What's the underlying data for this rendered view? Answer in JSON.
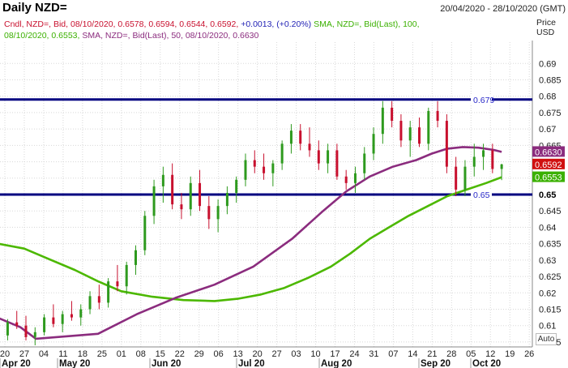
{
  "header": {
    "title": "Daily NZD=",
    "date_range": "20/04/2020 - 28/10/2020 (GMT)"
  },
  "legend": {
    "line1_cndl": "Cndl, NZD=, Bid, 08/10/2020, 0.6578, 0.6594, 0.6544, 0.6592,",
    "line1_change": "+0.0013, (+0.20%)",
    "line1_sma100": "SMA, NZD=, Bid(Last),  100,",
    "line2_sma100_value": "08/10/2020, 0.6553,",
    "line2_sma50": "SMA, NZD=, Bid(Last),  50, 08/10/2020, 0.6630"
  },
  "axis": {
    "price_label": "Price",
    "currency_label": "USD"
  },
  "controls": {
    "auto_label": "Auto"
  },
  "chart_data": {
    "type": "candlestick",
    "ylim": [
      0.6035,
      0.6965
    ],
    "y_ticks": [
      "0.69",
      "0.685",
      "0.68",
      "0.675",
      "0.67",
      "0.665",
      "0.66",
      "0.655",
      "0.65",
      "0.645",
      "0.64",
      "0.635",
      "0.63",
      "0.625",
      "0.62",
      "0.615",
      "0.61",
      "0.605"
    ],
    "x_ticks": [
      "20",
      "27",
      "04",
      "11",
      "18",
      "25",
      "01",
      "08",
      "15",
      "22",
      "29",
      "06",
      "13",
      "20",
      "27",
      "03",
      "10",
      "17",
      "24",
      "31",
      "07",
      "14",
      "21",
      "28",
      "05",
      "12",
      "19",
      "26"
    ],
    "month_labels": [
      "Apr 20",
      "May 20",
      "Jun 20",
      "Jul 20",
      "Aug 20",
      "Sep 20",
      "Oct 20"
    ],
    "horizontal_lines": [
      {
        "value": 0.679,
        "label": "0.679"
      },
      {
        "value": 0.65,
        "label": "0.65"
      }
    ],
    "price_tags": [
      {
        "value": 0.663,
        "label": "0.6630",
        "color": "#8b2c7e"
      },
      {
        "value": 0.6592,
        "label": "0.6592",
        "color": "#d01010"
      },
      {
        "value": 0.6553,
        "label": "0.6553",
        "color": "#3bb000"
      },
      {
        "value": 0.65,
        "label": "0.65",
        "color": "#ffffff"
      }
    ],
    "series": [
      {
        "name": "SMA 100",
        "color": "#4cb800",
        "points": [
          [
            -4,
            0.6355
          ],
          [
            5,
            0.6335
          ],
          [
            12,
            0.63
          ],
          [
            18,
            0.627
          ],
          [
            24,
            0.6235
          ],
          [
            30,
            0.6205
          ],
          [
            38,
            0.6188
          ],
          [
            46,
            0.6178
          ],
          [
            54,
            0.6175
          ],
          [
            60,
            0.6182
          ],
          [
            66,
            0.6195
          ],
          [
            72,
            0.6215
          ],
          [
            78,
            0.6245
          ],
          [
            84,
            0.628
          ],
          [
            89,
            0.632
          ],
          [
            94,
            0.6365
          ],
          [
            99,
            0.64
          ],
          [
            104,
            0.6435
          ],
          [
            109,
            0.6465
          ],
          [
            114,
            0.6495
          ],
          [
            119,
            0.6515
          ],
          [
            124,
            0.6535
          ],
          [
            128,
            0.6553
          ]
        ]
      },
      {
        "name": "SMA 50",
        "color": "#8b2c7e",
        "points": [
          [
            -4,
            0.6135
          ],
          [
            4,
            0.6095
          ],
          [
            8,
            0.606
          ],
          [
            24,
            0.6075
          ],
          [
            34,
            0.6135
          ],
          [
            44,
            0.6185
          ],
          [
            54,
            0.6225
          ],
          [
            64,
            0.628
          ],
          [
            74,
            0.6365
          ],
          [
            82,
            0.645
          ],
          [
            88,
            0.651
          ],
          [
            94,
            0.6555
          ],
          [
            100,
            0.6585
          ],
          [
            106,
            0.6605
          ],
          [
            110,
            0.6625
          ],
          [
            114,
            0.664
          ],
          [
            118,
            0.6645
          ],
          [
            122,
            0.6643
          ],
          [
            126,
            0.6636
          ],
          [
            128,
            0.663
          ]
        ]
      }
    ],
    "candles_ohlc_sampled": [
      [
        0.607,
        0.61,
        0.605,
        0.608
      ],
      [
        0.6085,
        0.611,
        0.606,
        0.607
      ],
      [
        0.607,
        0.612,
        0.6055,
        0.611
      ],
      [
        0.611,
        0.6145,
        0.609,
        0.61
      ],
      [
        0.61,
        0.613,
        0.6055,
        0.6065
      ],
      [
        0.6065,
        0.6095,
        0.604,
        0.608
      ],
      [
        0.608,
        0.6135,
        0.607,
        0.6125
      ],
      [
        0.6125,
        0.6165,
        0.6095,
        0.6105
      ],
      [
        0.6105,
        0.6145,
        0.608,
        0.6135
      ],
      [
        0.6135,
        0.6175,
        0.6115,
        0.6125
      ],
      [
        0.6125,
        0.6165,
        0.61,
        0.615
      ],
      [
        0.615,
        0.6205,
        0.6135,
        0.619
      ],
      [
        0.619,
        0.6225,
        0.615,
        0.617
      ],
      [
        0.617,
        0.6245,
        0.6155,
        0.6235
      ],
      [
        0.6235,
        0.6285,
        0.6205,
        0.622
      ],
      [
        0.622,
        0.6295,
        0.6195,
        0.6285
      ],
      [
        0.6285,
        0.6345,
        0.6255,
        0.633
      ],
      [
        0.633,
        0.645,
        0.6315,
        0.6435
      ],
      [
        0.6435,
        0.6545,
        0.641,
        0.6525
      ],
      [
        0.6525,
        0.6585,
        0.6475,
        0.656
      ],
      [
        0.656,
        0.6595,
        0.6455,
        0.647
      ],
      [
        0.647,
        0.6505,
        0.6425,
        0.6455
      ],
      [
        0.6455,
        0.6555,
        0.6435,
        0.6535
      ],
      [
        0.6535,
        0.6575,
        0.645,
        0.6465
      ],
      [
        0.6465,
        0.6495,
        0.6395,
        0.6425
      ],
      [
        0.6425,
        0.6485,
        0.6385,
        0.6465
      ],
      [
        0.6465,
        0.6525,
        0.644,
        0.6505
      ],
      [
        0.6505,
        0.6555,
        0.6475,
        0.6545
      ],
      [
        0.6545,
        0.6625,
        0.6525,
        0.6605
      ],
      [
        0.6605,
        0.6635,
        0.6565,
        0.6585
      ],
      [
        0.6585,
        0.6625,
        0.6545,
        0.6565
      ],
      [
        0.6565,
        0.6605,
        0.6525,
        0.6595
      ],
      [
        0.6595,
        0.6665,
        0.6575,
        0.6655
      ],
      [
        0.6655,
        0.6715,
        0.6625,
        0.6695
      ],
      [
        0.6695,
        0.6715,
        0.6635,
        0.6655
      ],
      [
        0.6655,
        0.6705,
        0.6615,
        0.6635
      ],
      [
        0.6635,
        0.6665,
        0.6575,
        0.6595
      ],
      [
        0.6595,
        0.6655,
        0.6565,
        0.6635
      ],
      [
        0.6635,
        0.6655,
        0.6545,
        0.6555
      ],
      [
        0.6555,
        0.6575,
        0.6515,
        0.6535
      ],
      [
        0.6535,
        0.6585,
        0.6505,
        0.6565
      ],
      [
        0.6565,
        0.6645,
        0.6545,
        0.6625
      ],
      [
        0.6625,
        0.6705,
        0.6605,
        0.6685
      ],
      [
        0.6685,
        0.6785,
        0.6655,
        0.6765
      ],
      [
        0.6765,
        0.6785,
        0.6705,
        0.6725
      ],
      [
        0.6725,
        0.6745,
        0.6645,
        0.6665
      ],
      [
        0.6665,
        0.6725,
        0.6615,
        0.6705
      ],
      [
        0.6705,
        0.6735,
        0.6645,
        0.6655
      ],
      [
        0.6655,
        0.6765,
        0.6635,
        0.6755
      ],
      [
        0.6755,
        0.6785,
        0.6705,
        0.6725
      ],
      [
        0.6725,
        0.6745,
        0.6565,
        0.6585
      ],
      [
        0.6585,
        0.6615,
        0.6495,
        0.6515
      ],
      [
        0.6515,
        0.6605,
        0.6495,
        0.6585
      ],
      [
        0.6585,
        0.6655,
        0.6555,
        0.6615
      ],
      [
        0.6615,
        0.6655,
        0.6575,
        0.6635
      ],
      [
        0.6635,
        0.6655,
        0.6565,
        0.6578
      ],
      [
        0.6578,
        0.6594,
        0.6544,
        0.6592
      ]
    ]
  }
}
